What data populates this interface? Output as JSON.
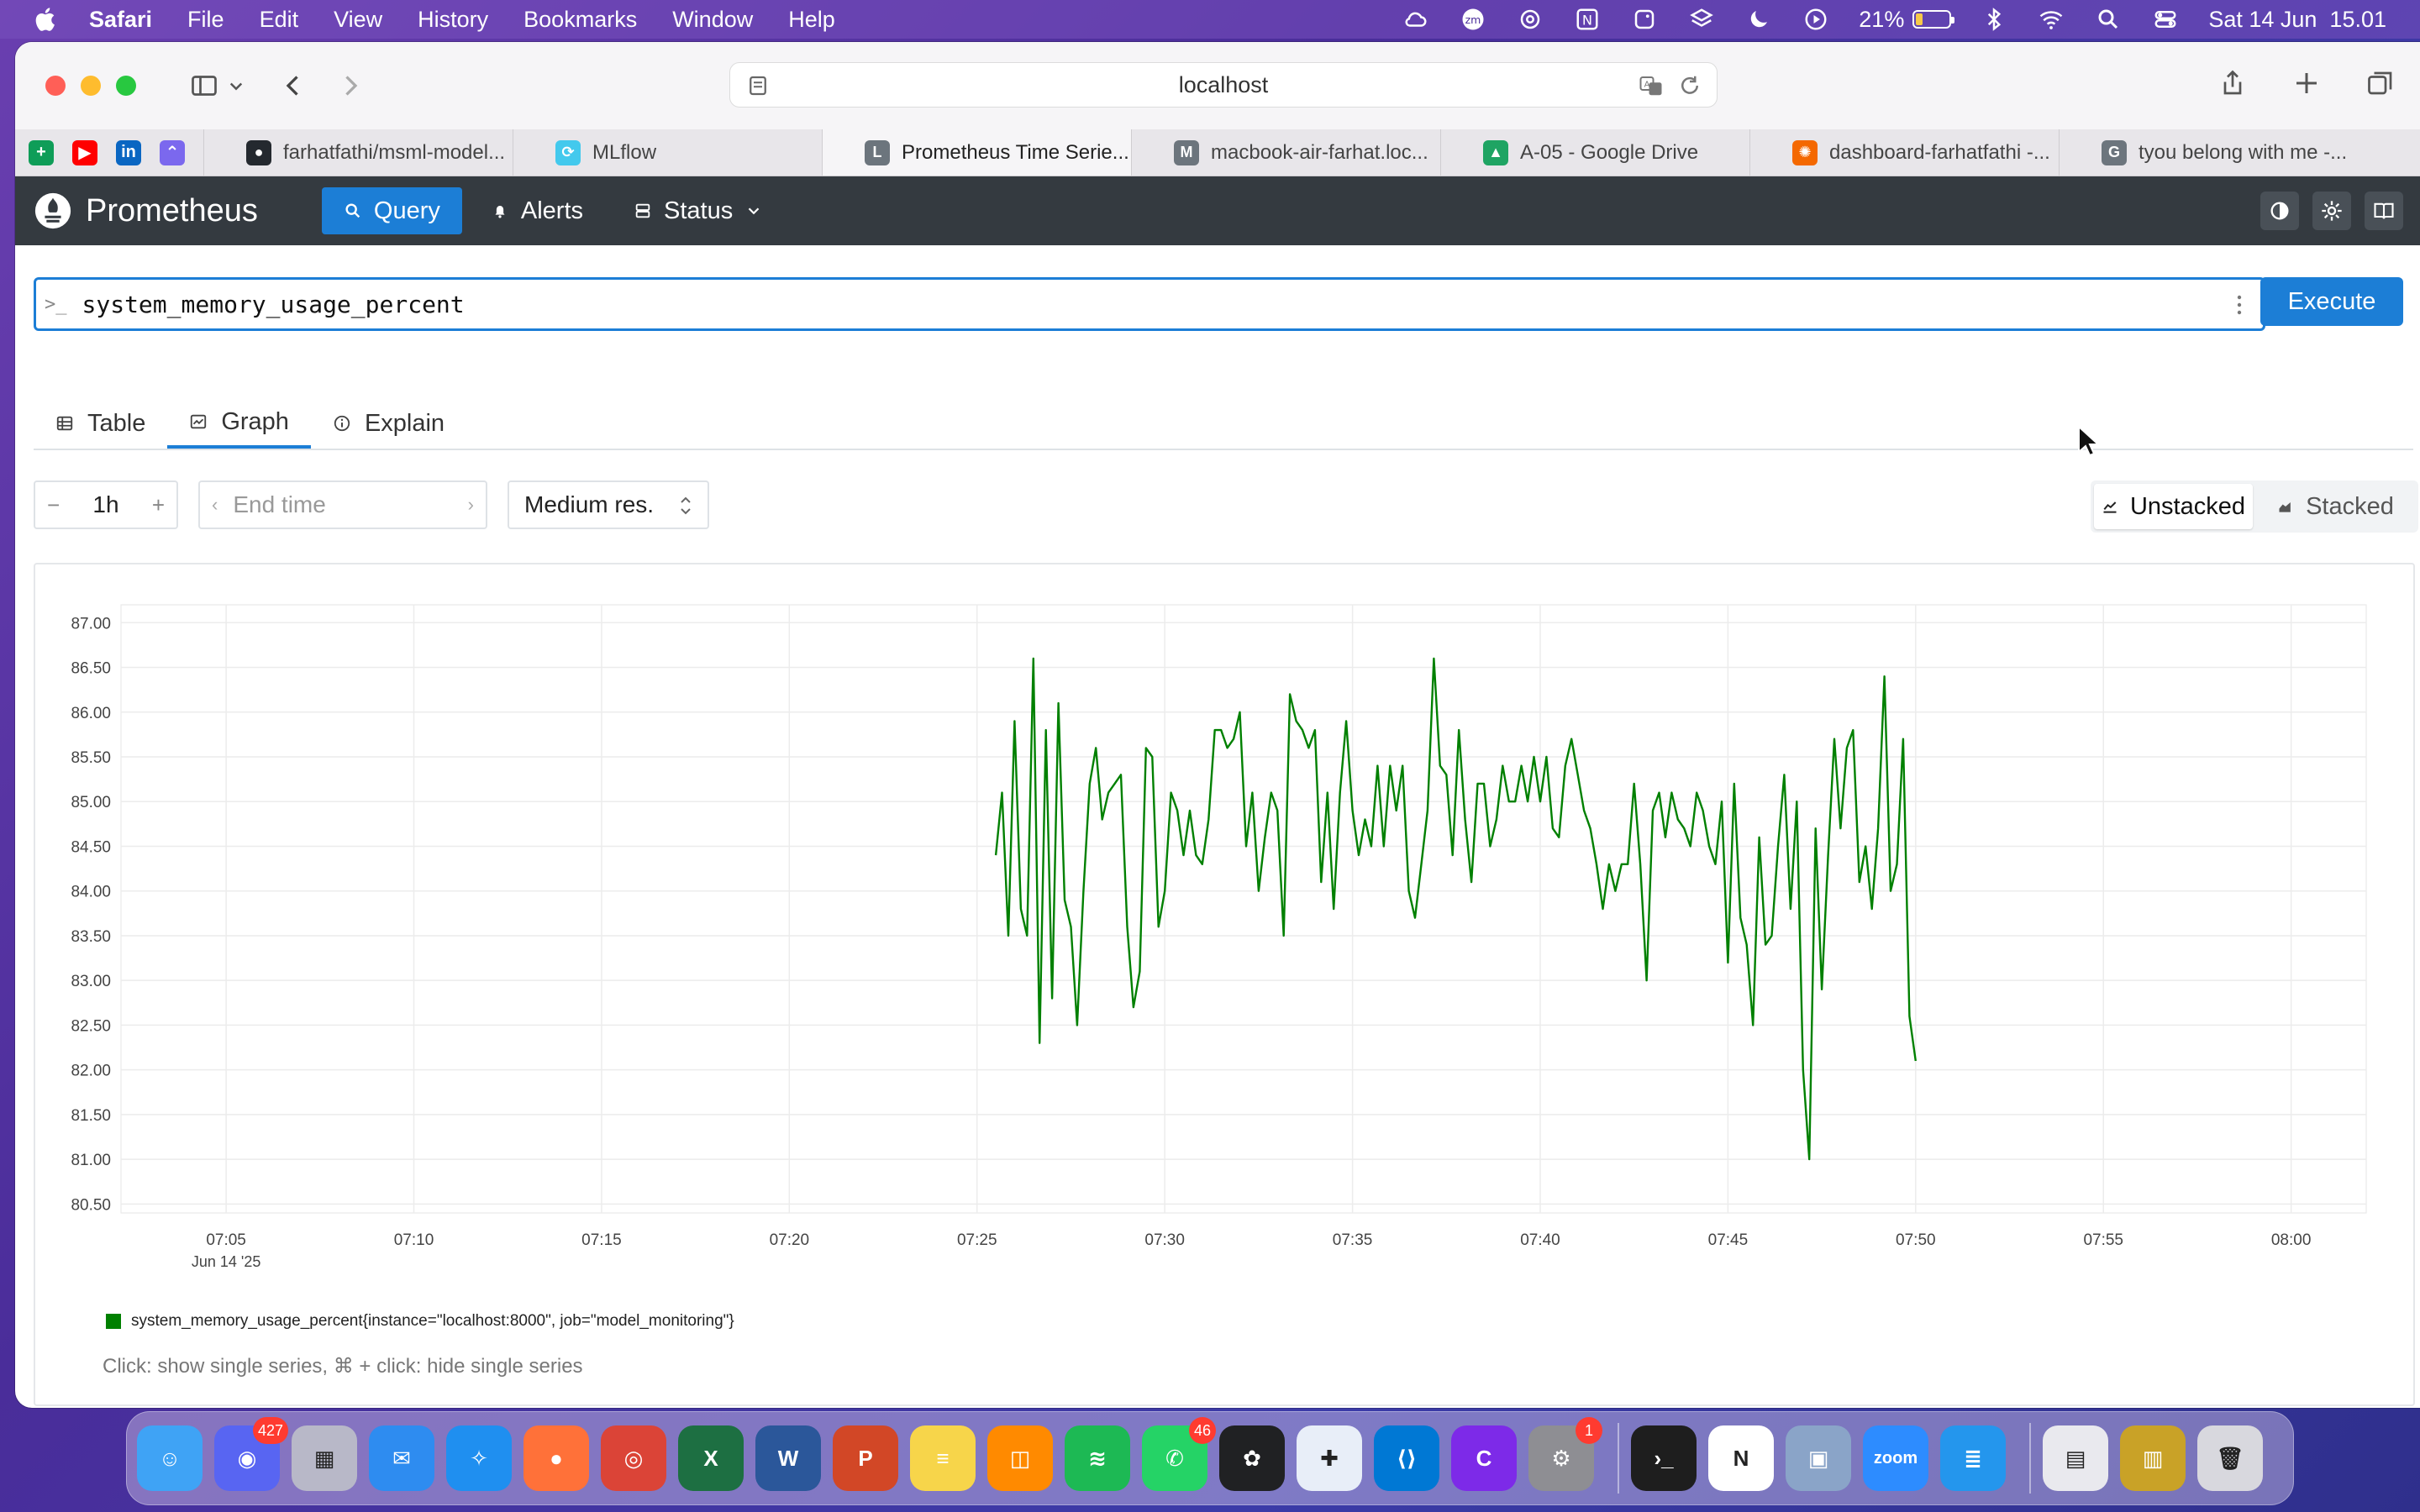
{
  "menubar": {
    "app_name": "Safari",
    "menus": [
      "File",
      "Edit",
      "View",
      "History",
      "Bookmarks",
      "Window",
      "Help"
    ],
    "battery_percent": "21%",
    "battery_level": 0.21,
    "datetime": "Sat 14 Jun  15.01"
  },
  "browser": {
    "url": "localhost",
    "tabs": [
      {
        "title": "farhatfathi/msml-model...",
        "icon_color": "#24292f",
        "icon_letter": "●",
        "active": false
      },
      {
        "title": "MLflow",
        "icon_color": "#43c9ed",
        "icon_letter": "⟳",
        "active": false
      },
      {
        "title": "Prometheus Time Serie...",
        "icon_color": "#6c757d",
        "icon_letter": "L",
        "active": true
      },
      {
        "title": "macbook-air-farhat.loc...",
        "icon_color": "#6c757d",
        "icon_letter": "M",
        "active": false
      },
      {
        "title": "A-05 - Google Drive",
        "icon_color": "#1fa463",
        "icon_letter": "▲",
        "active": false
      },
      {
        "title": "dashboard-farhatfathi -...",
        "icon_color": "#f46800",
        "icon_letter": "✺",
        "active": false
      },
      {
        "title": "tyou belong with me -...",
        "icon_color": "#6c757d",
        "icon_letter": "G",
        "active": false
      }
    ],
    "favorites": [
      {
        "name": "sheets",
        "color": "#0f9d58",
        "glyph": "+"
      },
      {
        "name": "youtube",
        "color": "#ff0000",
        "glyph": "▶"
      },
      {
        "name": "linkedin",
        "color": "#0a66c2",
        "glyph": "in"
      },
      {
        "name": "clickup",
        "color": "#7b68ee",
        "glyph": "⌃"
      }
    ]
  },
  "prometheus": {
    "title": "Prometheus",
    "nav": {
      "query": "Query",
      "alerts": "Alerts",
      "status": "Status"
    },
    "query": "system_memory_usage_percent",
    "execute_label": "Execute",
    "tabs": {
      "table": "Table",
      "graph": "Graph",
      "explain": "Explain"
    },
    "range": "1h",
    "end_time_placeholder": "End time",
    "resolution": "Medium res.",
    "stack": {
      "unstacked": "Unstacked",
      "stacked": "Stacked"
    },
    "legend": "system_memory_usage_percent{instance=\"localhost:8000\", job=\"model_monitoring\"}",
    "hint": "Click: show single series, ⌘ + click: hide single series"
  },
  "chart_data": {
    "type": "line",
    "title": "",
    "xlabel": "",
    "ylabel": "",
    "x_range_minutes": [
      7.0,
      8.4
    ],
    "ylim": [
      80.4,
      87.2
    ],
    "y_ticks": [
      "87.00",
      "86.50",
      "86.00",
      "85.50",
      "85.00",
      "84.50",
      "84.00",
      "83.50",
      "83.00",
      "82.50",
      "82.00",
      "81.50",
      "81.00",
      "80.50"
    ],
    "x_ticks": [
      "07:05",
      "07:10",
      "07:15",
      "07:20",
      "07:25",
      "07:30",
      "07:35",
      "07:40",
      "07:45",
      "07:50",
      "07:55",
      "08:00"
    ],
    "x_tick_sublabel": "Jun 14 '25",
    "grid": true,
    "color": "#008000",
    "series": [
      {
        "name": "system_memory_usage_percent{instance=\"localhost:8000\", job=\"model_monitoring\"}",
        "start_time": "07:25:30",
        "step_seconds": 10,
        "values": [
          84.4,
          85.1,
          83.5,
          85.9,
          83.8,
          83.5,
          86.6,
          82.3,
          85.8,
          82.8,
          86.1,
          83.9,
          83.6,
          82.5,
          84.0,
          85.2,
          85.6,
          84.8,
          85.1,
          85.2,
          85.3,
          83.6,
          82.7,
          83.1,
          85.6,
          85.5,
          83.6,
          84.0,
          85.1,
          84.9,
          84.4,
          84.9,
          84.4,
          84.3,
          84.8,
          85.8,
          85.8,
          85.6,
          85.7,
          86.0,
          84.5,
          85.1,
          84.0,
          84.6,
          85.1,
          84.9,
          83.5,
          86.2,
          85.9,
          85.8,
          85.6,
          85.8,
          84.1,
          85.1,
          83.8,
          85.1,
          85.9,
          84.9,
          84.4,
          84.8,
          84.5,
          85.4,
          84.5,
          85.4,
          84.9,
          85.4,
          84.0,
          83.7,
          84.3,
          84.9,
          86.6,
          85.4,
          85.3,
          84.4,
          85.8,
          84.8,
          84.1,
          85.2,
          85.2,
          84.5,
          84.8,
          85.4,
          85.0,
          85.0,
          85.4,
          85.0,
          85.5,
          85.0,
          85.5,
          84.7,
          84.6,
          85.4,
          85.7,
          85.3,
          84.9,
          84.7,
          84.3,
          83.8,
          84.3,
          84.0,
          84.3,
          84.3,
          85.2,
          84.3,
          83.0,
          84.9,
          85.1,
          84.6,
          85.1,
          84.8,
          84.7,
          84.5,
          85.1,
          84.9,
          84.5,
          84.3,
          85.0,
          83.2,
          85.2,
          83.7,
          83.4,
          82.5,
          84.6,
          83.4,
          83.5,
          84.5,
          85.3,
          83.8,
          85.0,
          82.0,
          81.0,
          84.7,
          82.9,
          84.4,
          85.7,
          84.7,
          85.6,
          85.8,
          84.1,
          84.5,
          83.8,
          84.7,
          86.4,
          84.0,
          84.3,
          85.7,
          82.6,
          82.1
        ]
      }
    ]
  },
  "dock": [
    {
      "name": "finder",
      "color": "#3fa3f5",
      "glyph": "☺"
    },
    {
      "name": "discord",
      "color": "#5865f2",
      "glyph": "◉",
      "badge": "427"
    },
    {
      "name": "launchpad",
      "color": "#b8b8c8",
      "glyph": "▦"
    },
    {
      "name": "mail",
      "color": "#2e8cf0",
      "glyph": "✉"
    },
    {
      "name": "safari",
      "color": "#1f8ff0",
      "glyph": "✧"
    },
    {
      "name": "firefox",
      "color": "#ff7139",
      "glyph": "●"
    },
    {
      "name": "chrome",
      "color": "#db4437",
      "glyph": "◎"
    },
    {
      "name": "excel",
      "color": "#1d6f42",
      "glyph": "X"
    },
    {
      "name": "word",
      "color": "#2b579a",
      "glyph": "W"
    },
    {
      "name": "powerpoint",
      "color": "#d24726",
      "glyph": "P"
    },
    {
      "name": "notes",
      "color": "#f7d54a",
      "glyph": "≡"
    },
    {
      "name": "books",
      "color": "#ff8a00",
      "glyph": "◫"
    },
    {
      "name": "spotify",
      "color": "#1db954",
      "glyph": "≋"
    },
    {
      "name": "whatsapp",
      "color": "#25d366",
      "glyph": "✆",
      "badge": "46"
    },
    {
      "name": "chatgpt",
      "color": "#202123",
      "glyph": "✿"
    },
    {
      "name": "tableau",
      "color": "#e8eef8",
      "glyph": "✚"
    },
    {
      "name": "vscode",
      "color": "#0078d4",
      "glyph": "⟨⟩"
    },
    {
      "name": "canva",
      "color": "#7d2ae8",
      "glyph": "C"
    },
    {
      "name": "system-settings",
      "color": "#8e8e93",
      "glyph": "⚙",
      "badge": "1"
    },
    {
      "name": "separator"
    },
    {
      "name": "terminal",
      "color": "#1e1e1e",
      "glyph": "›_"
    },
    {
      "name": "notion",
      "color": "#ffffff",
      "glyph": "N"
    },
    {
      "name": "preview",
      "color": "#8aa4c8",
      "glyph": "▣"
    },
    {
      "name": "zoom",
      "color": "#2d8cff",
      "glyph": "zoom"
    },
    {
      "name": "docker",
      "color": "#2496ed",
      "glyph": "≣"
    },
    {
      "name": "separator"
    },
    {
      "name": "documents",
      "color": "#e9e9ee",
      "glyph": "▤"
    },
    {
      "name": "downloads",
      "color": "#c9a227",
      "glyph": "▥"
    },
    {
      "name": "trash",
      "color": "#d8d8de",
      "glyph": "🗑"
    }
  ]
}
